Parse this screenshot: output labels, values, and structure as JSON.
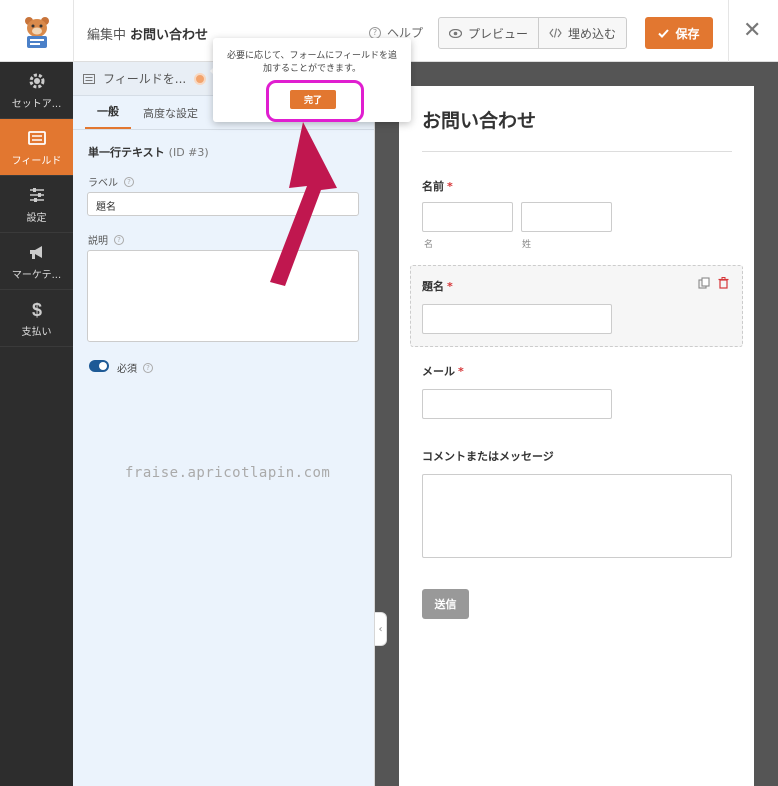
{
  "header": {
    "editing_prefix": "編集中",
    "form_name": "お問い合わせ",
    "help_label": "ヘルプ",
    "preview_label": "プレビュー",
    "embed_label": "埋め込む",
    "save_label": "保存"
  },
  "sidebar": {
    "items": [
      {
        "label": "セットア...",
        "icon": "gear-icon"
      },
      {
        "label": "フィールド",
        "icon": "fields-icon"
      },
      {
        "label": "設定",
        "icon": "sliders-icon"
      },
      {
        "label": "マーケテ...",
        "icon": "megaphone-icon"
      },
      {
        "label": "支払い",
        "icon": "dollar-icon"
      }
    ]
  },
  "panel": {
    "head_label": "フィールドを...",
    "tabs": [
      "一般",
      "高度な設定"
    ],
    "field_type": "単一行テキスト",
    "field_id": "(ID #3)",
    "label_caption": "ラベル",
    "label_value": "題名",
    "description_caption": "説明",
    "required_caption": "必須"
  },
  "tooltip": {
    "text": "必要に応じて、フォームにフィールドを追加することができます。",
    "done_label": "完了"
  },
  "watermark": "fraise.apricotlapin.com",
  "form": {
    "title": "お問い合わせ",
    "name_label": "名前",
    "first_sub": "名",
    "last_sub": "姓",
    "subject_label": "題名",
    "email_label": "メール",
    "message_label": "コメントまたはメッセージ",
    "submit_label": "送信",
    "required_mark": "*"
  },
  "colors": {
    "accent": "#e27730",
    "sidebar_bg": "#2d2d2d",
    "panel_bg": "#ebf3fc",
    "highlight": "#e01ed0",
    "arrow": "#c0174f"
  }
}
